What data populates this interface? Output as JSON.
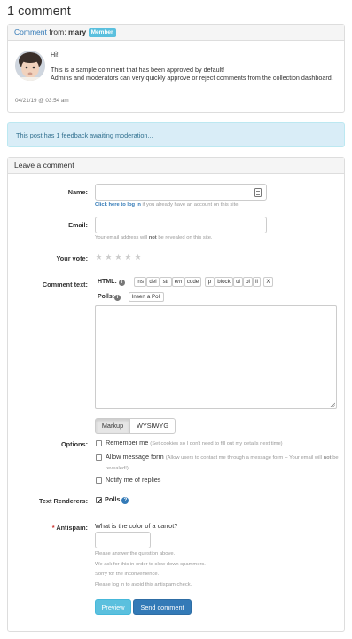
{
  "page_title": "1 comment",
  "comment": {
    "link_text": "Comment",
    "from_text": " from: ",
    "author": "mary",
    "badge": "Member",
    "lines": [
      "Hi!",
      "This is a sample comment that has been approved by default!",
      "Admins and moderators can very quickly approve or reject comments from the collection dashboard."
    ],
    "date": "04/21/19 @ 03:54 am"
  },
  "moderation_notice": "This post has 1 feedback awaiting moderation...",
  "form": {
    "heading": "Leave a comment",
    "name_label": "Name:",
    "login_link": "Click here to log in",
    "login_help": " if you already have an account on this site.",
    "email_label": "Email:",
    "email_help_1": "Your email address will ",
    "email_help_bold": "not",
    "email_help_2": " be revealed on this site.",
    "vote_label": "Your vote:",
    "stars": [
      "★",
      "★",
      "★",
      "★",
      "★"
    ],
    "comment_label": "Comment text:",
    "html_label": "HTML:",
    "html_buttons": [
      "ins",
      "del",
      "str",
      "em",
      "code",
      "p",
      "block",
      "ul",
      "ol",
      "li",
      "X"
    ],
    "polls_label": "Polls:",
    "insert_poll": "Insert a Poll",
    "editor_tabs": [
      "Markup",
      "WYSIWYG"
    ],
    "options_label": "Options:",
    "remember_label": "Remember me",
    "remember_note": "(Set cookies so I don't need to fill out my details next time)",
    "allow_label": "Allow message form",
    "allow_note_1": "(Allow users to contact me through a message form -- Your email will ",
    "allow_note_bold": "not",
    "allow_note_2": " be revealed!)",
    "notify_label": "Notify me of replies",
    "renderers_label": "Text Renderers:",
    "polls_renderer": "Polls",
    "antispam_label": "Antispam:",
    "antispam_required": "*",
    "antispam_question": "What is the color of a carrot?",
    "antispam_help": [
      "Please answer the question above.",
      "We ask for this in order to slow down spammers.",
      "Sorry for the inconvenience.",
      "Please log in to avoid this antispam check."
    ],
    "preview_button": "Preview",
    "send_button": "Send comment"
  }
}
